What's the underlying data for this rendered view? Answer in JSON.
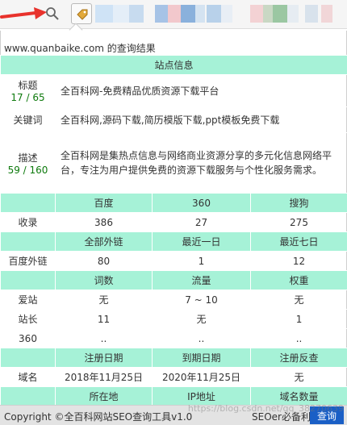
{
  "colors": {
    "header_bg": "#a6f2d7",
    "count_green": "#0e7a0d",
    "query_button": "#1a5fc6",
    "arrow_red": "#e8322c"
  },
  "toolbar": {
    "search_icon": "search-icon",
    "extension_icon": "tag-icon"
  },
  "popup": {
    "result_title": "www.quanbaike.com 的查询结果",
    "site_info_header": "站点信息",
    "title_label": "标题",
    "title_count": "17 / 65",
    "title_value": "全百科网-免费精品优质资源下载平台",
    "keywords_label": "关键词",
    "keywords_value": "全百科网,源码下载,简历模版下载,ppt模板免费下载",
    "desc_label": "描述",
    "desc_count": "59 / 160",
    "desc_value": "全百科网是集热点信息与网络商业资源分享的多元化信息网络平台，专注为用户提供免费的资源下载服务与个性化服务需求。",
    "engines": [
      "百度",
      "360",
      "搜狗"
    ],
    "index_label": "收录",
    "index_values": [
      "386",
      "27",
      "275"
    ],
    "backlink_headers": [
      "全部外链",
      "最近一日",
      "最近七日"
    ],
    "backlink_label": "百度外链",
    "backlink_values": [
      "80",
      "1",
      "12"
    ],
    "rank_headers": [
      "词数",
      "流量",
      "权重"
    ],
    "rank_rows": [
      {
        "label": "爱站",
        "values": [
          "无",
          "7 ~ 10",
          "无"
        ]
      },
      {
        "label": "站长",
        "values": [
          "11",
          "无",
          "1"
        ]
      },
      {
        "label": "360",
        "values": [
          "..",
          "..",
          ".."
        ]
      }
    ],
    "reg_headers": [
      "注册日期",
      "到期日期",
      "注册反查"
    ],
    "domain_label": "域名",
    "reg_values": [
      "2018年11月25日",
      "2020年11月25日",
      "无"
    ],
    "location_headers": [
      "所在地",
      "IP地址",
      "域名数量"
    ]
  },
  "footer": {
    "copyright": "Copyright ©全百科网站SEO查询工具v1.0",
    "feedback": "SEOer必备利器 反馈",
    "query_button": "查询"
  },
  "watermark": "https://blog.csdn.net/qq_38270639"
}
